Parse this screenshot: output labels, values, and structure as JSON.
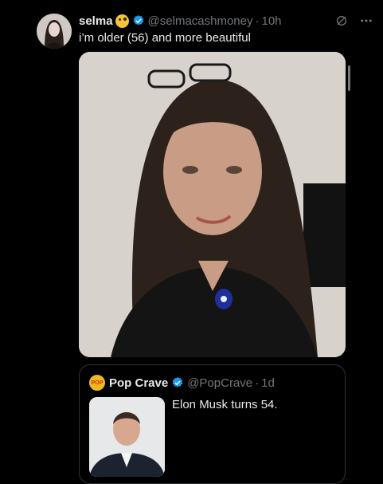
{
  "tweet": {
    "author_name": "selma",
    "handle": "@selmacashmoney",
    "separator": "·",
    "time": "10h",
    "text": "i’m older (56) and more beautiful",
    "icons": [
      "grok-icon",
      "more-icon"
    ]
  },
  "quote": {
    "author_name": "Pop Crave",
    "avatar_text": "POP",
    "handle": "@PopCrave",
    "separator": "·",
    "time": "1d",
    "text": "Elon Musk turns 54."
  },
  "colors": {
    "background": "#000000",
    "text": "#e7e9ea",
    "muted": "#71767b",
    "verified": "#1d9bf0",
    "border": "#2f3336"
  }
}
